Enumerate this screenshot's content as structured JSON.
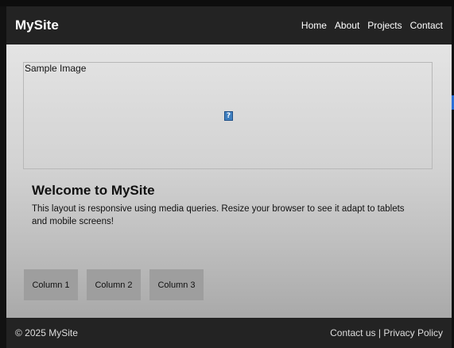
{
  "header": {
    "logo": "MySite",
    "nav": [
      "Home",
      "About",
      "Projects",
      "Contact"
    ]
  },
  "hero": {
    "alt_text": "Sample Image",
    "broken_icon_glyph": "?"
  },
  "welcome": {
    "title": "Welcome to MySite",
    "body": "This layout is responsive using media queries. Resize your browser to see it adapt to tablets and mobile screens!"
  },
  "columns": [
    "Column 1",
    "Column 2",
    "Column 3"
  ],
  "footer": {
    "copyright": "© 2025 MySite",
    "contact": "Contact us",
    "separator": " | ",
    "privacy": "Privacy Policy"
  },
  "colors": {
    "header_bg": "#232323",
    "footer_bg": "#232323",
    "column_bg": "#9e9e9e",
    "accent_tab": "#2b6fd6"
  }
}
